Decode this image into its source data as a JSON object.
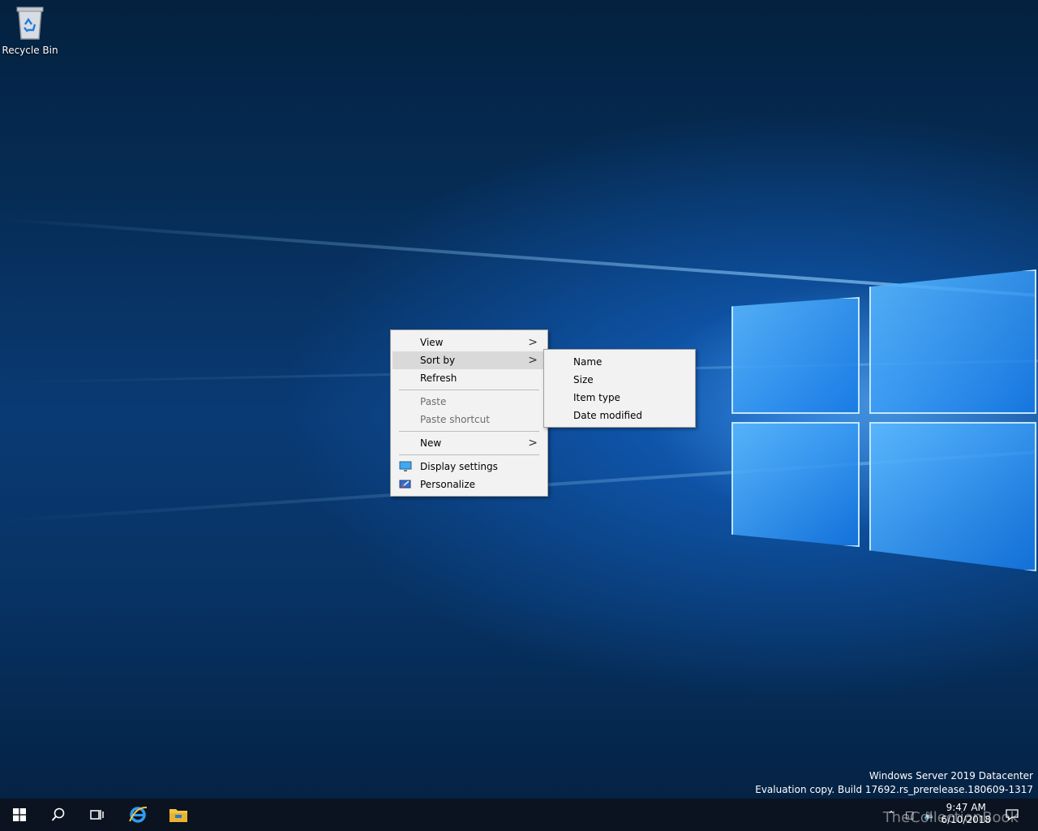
{
  "desktop": {
    "icons": [
      {
        "label": "Recycle Bin",
        "icon": "recycle-bin-icon"
      }
    ]
  },
  "context_menu": {
    "items": [
      {
        "label": "View",
        "submenu": true
      },
      {
        "label": "Sort by",
        "submenu": true,
        "highlighted": true
      },
      {
        "label": "Refresh"
      },
      {
        "label": "Paste",
        "disabled": true
      },
      {
        "label": "Paste shortcut",
        "disabled": true
      },
      {
        "label": "New",
        "submenu": true
      },
      {
        "label": "Display settings",
        "icon": "display-icon"
      },
      {
        "label": "Personalize",
        "icon": "personalize-icon"
      }
    ]
  },
  "sort_submenu": {
    "items": [
      "Name",
      "Size",
      "Item type",
      "Date modified"
    ]
  },
  "watermark": {
    "line1": "Windows Server 2019 Datacenter",
    "line2": "Evaluation copy. Build 17692.rs_prerelease.180609-1317"
  },
  "taskbar": {
    "time": "9:47 AM",
    "date": "6/10/2018",
    "overlay_text": "TheCollectionBook"
  },
  "colors": {
    "accent": "#0078d7",
    "menu_bg": "#f2f2f2",
    "taskbar": "#0b1320"
  }
}
